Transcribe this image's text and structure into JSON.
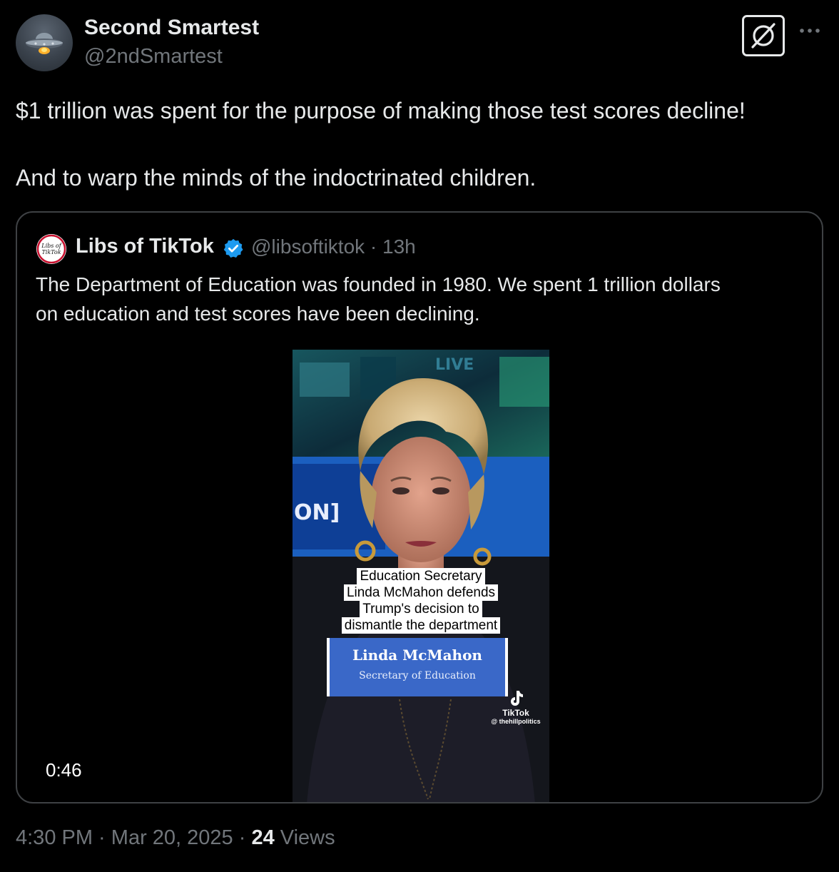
{
  "author": {
    "name": "Second Smartest",
    "handle": "@2ndSmartest",
    "avatar_icon": "ufo-icon"
  },
  "header_actions": {
    "grok_icon": "grok-icon",
    "more_label": "···"
  },
  "tweet": {
    "line1": "$1 trillion was spent for the purpose of making those test scores decline!",
    "line2": "And to warp the minds of the indoctrinated children."
  },
  "quoted": {
    "avatar_text_top": "Libs of",
    "avatar_text_bottom": "TikTok",
    "name": "Libs of TikTok",
    "verified_icon": "verified-badge-icon",
    "handle": "@libsoftiktok",
    "separator": " · ",
    "time": "13h",
    "text_line1": "The Department of Education was founded in 1980. We spent 1 trillion dollars",
    "text_line2": "on education and test scores have been declining.",
    "video": {
      "duration": "0:46",
      "caption_lines": [
        "Education Secretary",
        "Linda McMahon defends",
        "Trump's decision to",
        "dismantle the department"
      ],
      "lower_third_name": "Linda McMahon",
      "lower_third_title": "Secretary of Education",
      "background_sign": "ON]",
      "live_sign": "LIVE",
      "watermark_brand": "TikTok",
      "watermark_user": "@ thehillpolitics"
    }
  },
  "footer": {
    "time": "4:30 PM",
    "sep1": " · ",
    "date": "Mar 20, 2025",
    "sep2": " · ",
    "views_count": "24",
    "views_label": " Views"
  },
  "colors": {
    "background": "#000000",
    "text_primary": "#e7e9ea",
    "text_secondary": "#71767b",
    "border": "#3e4144",
    "verified_blue": "#1d9bf0",
    "lower_third_blue": "#3a68c8"
  }
}
